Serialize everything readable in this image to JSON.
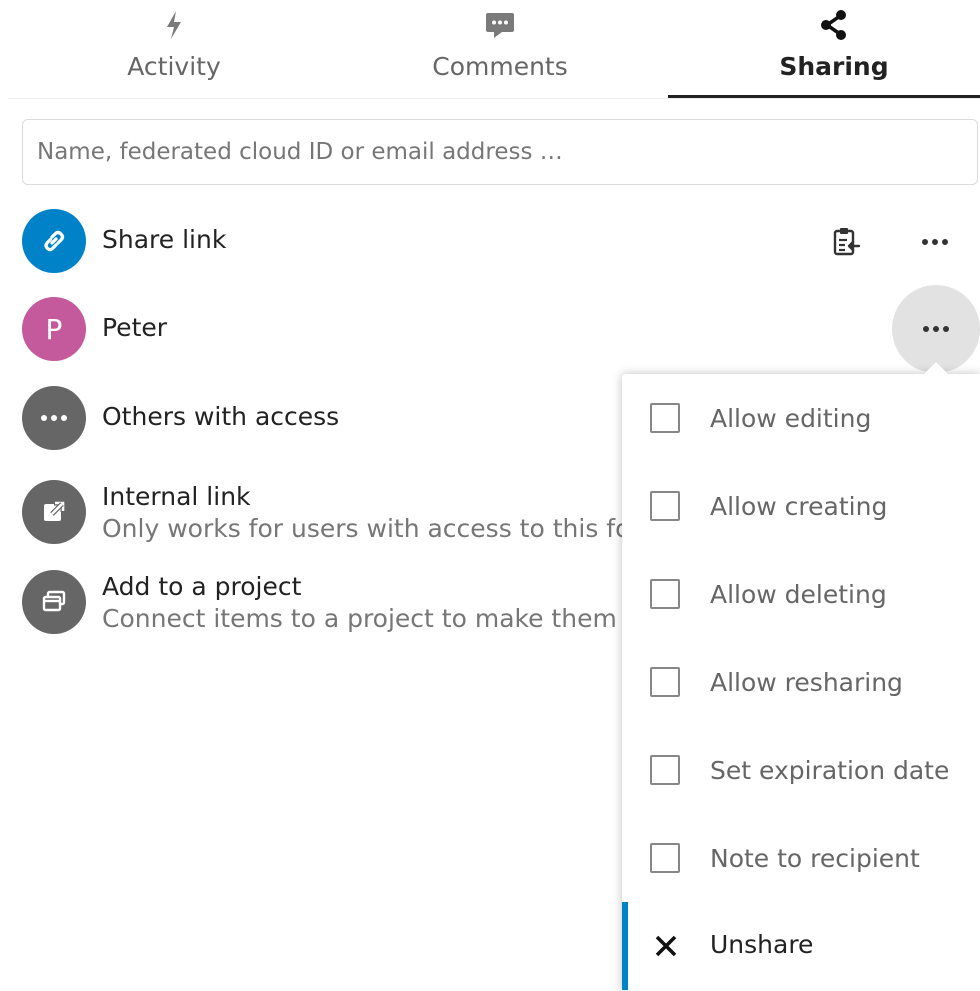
{
  "tabs": [
    {
      "label": "Activity",
      "icon": "lightning-icon"
    },
    {
      "label": "Comments",
      "icon": "comment-icon"
    },
    {
      "label": "Sharing",
      "icon": "share-icon",
      "active": true
    }
  ],
  "search": {
    "placeholder": "Name, federated cloud ID or email address …"
  },
  "rows": {
    "share_link": {
      "title": "Share link",
      "color": "#0082c9"
    },
    "peter": {
      "title": "Peter",
      "initial": "P",
      "color": "#c45a9b"
    },
    "others": {
      "title": "Others with access",
      "color": "#666666"
    },
    "internal": {
      "title": "Internal link",
      "subtitle": "Only works for users with access to this folder",
      "color": "#666666"
    },
    "project": {
      "title": "Add to a project",
      "subtitle": "Connect items to a project to make them easier to find",
      "color": "#666666"
    }
  },
  "menu": {
    "items": [
      {
        "label": "Allow editing",
        "checked": false
      },
      {
        "label": "Allow creating",
        "checked": false
      },
      {
        "label": "Allow deleting",
        "checked": false
      },
      {
        "label": "Allow resharing",
        "checked": false
      },
      {
        "label": "Set expiration date",
        "checked": false
      },
      {
        "label": "Note to recipient",
        "checked": false
      }
    ],
    "unshare": "Unshare",
    "accent": "#0082c9"
  }
}
